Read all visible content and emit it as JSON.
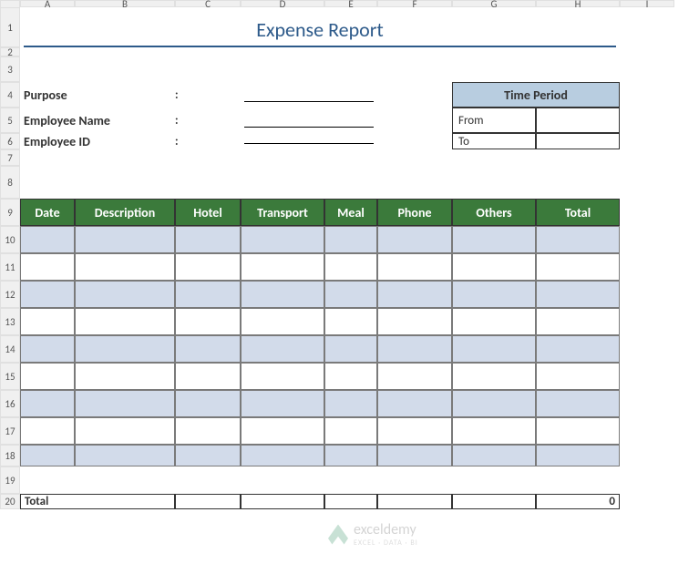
{
  "columns": [
    "A",
    "B",
    "C",
    "D",
    "E",
    "F",
    "G",
    "H",
    "I"
  ],
  "rows": [
    "1",
    "2",
    "3",
    "4",
    "5",
    "6",
    "7",
    "8",
    "9",
    "10",
    "11",
    "12",
    "13",
    "14",
    "15",
    "16",
    "17",
    "18",
    "19",
    "20"
  ],
  "title": "Expense Report",
  "form": {
    "purpose_label": "Purpose",
    "employee_name_label": "Employee Name",
    "employee_id_label": "Employee ID",
    "colon": ":"
  },
  "time_period": {
    "header": "Time Period",
    "from_label": "From",
    "to_label": "To",
    "from_value": "",
    "to_value": ""
  },
  "table": {
    "headers": [
      "Date",
      "Description",
      "Hotel",
      "Transport",
      "Meal",
      "Phone",
      "Others",
      "Total"
    ],
    "footer_label": "Total",
    "footer_total": "0"
  },
  "watermark": {
    "name": "exceldemy",
    "tagline": "EXCEL · DATA · BI"
  }
}
